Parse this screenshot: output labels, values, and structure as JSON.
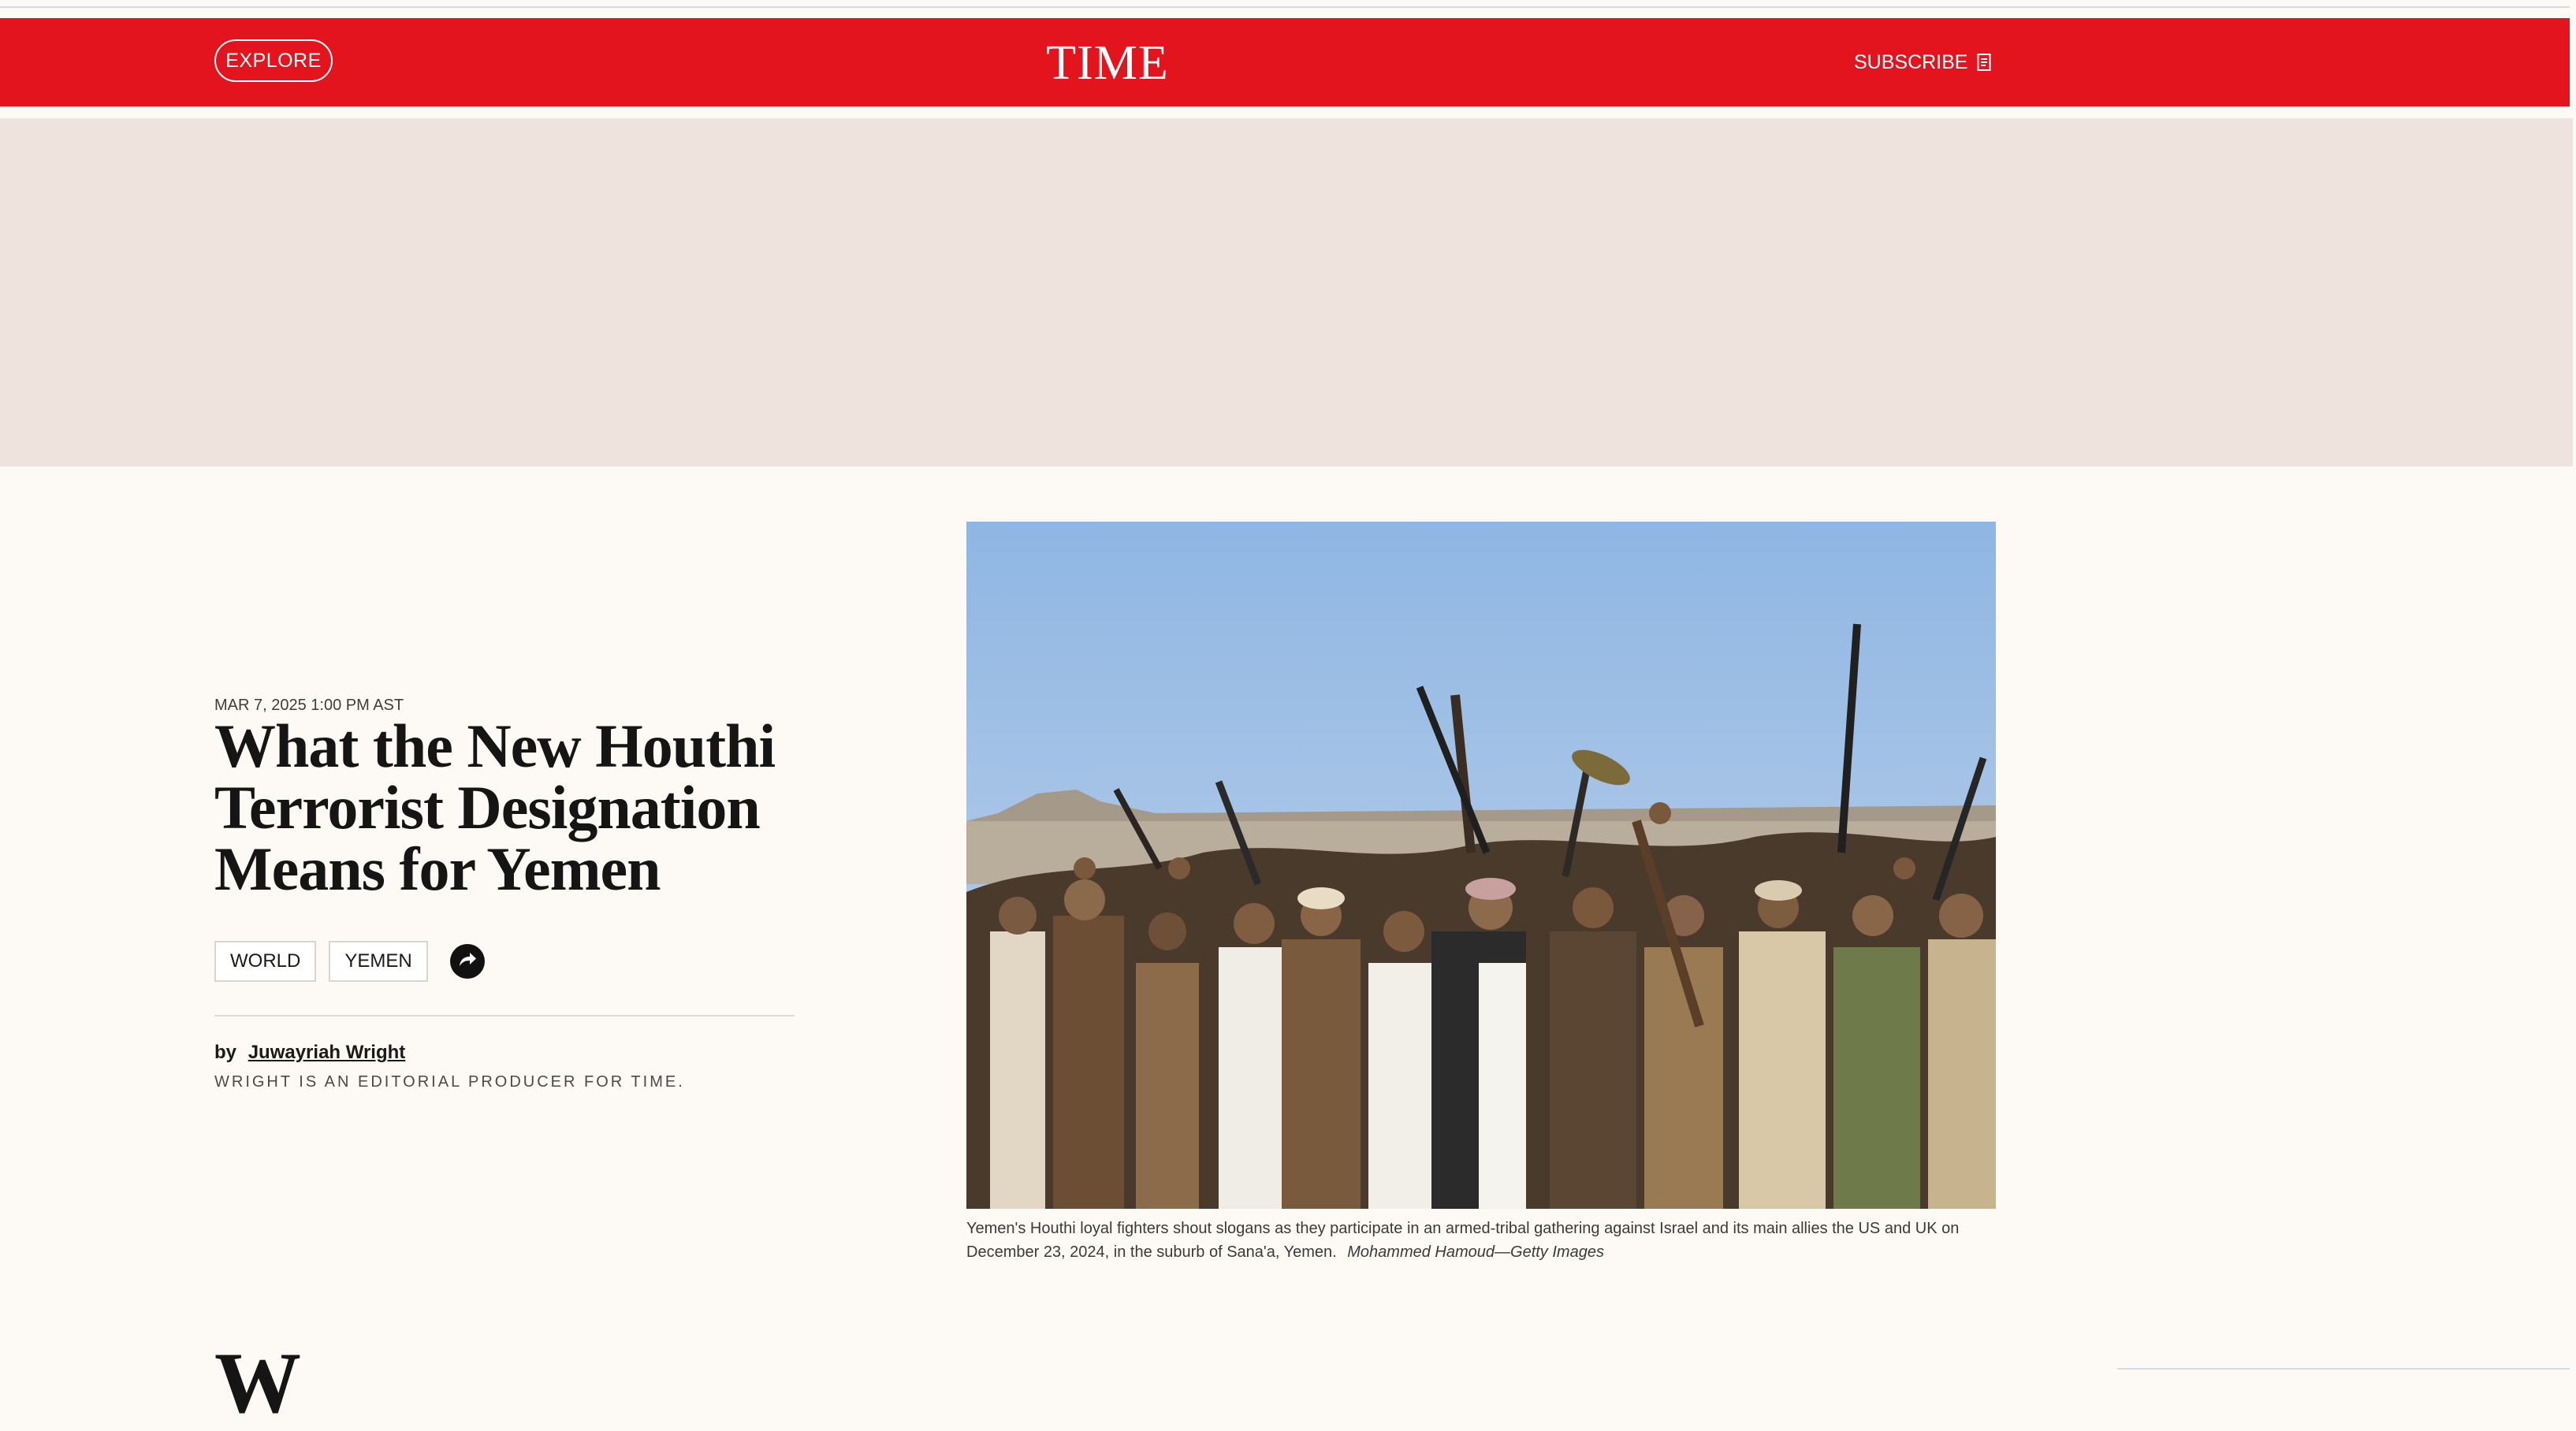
{
  "header": {
    "explore_label": "EXPLORE",
    "logo_text": "TIME",
    "subscribe_label": "SUBSCRIBE",
    "brand_color": "#e3141e"
  },
  "article": {
    "date": "MAR 7, 2025 1:00 PM AST",
    "headline": "What the New Houthi Terrorist Designation Means for Yemen",
    "tags": [
      "WORLD",
      "YEMEN"
    ],
    "share_icon": "share-arrow-icon",
    "byline_prefix": "by",
    "author": "Juwayriah Wright",
    "author_description": "WRIGHT IS AN EDITORIAL PRODUCER FOR TIME.",
    "photo": {
      "caption": "Yemen's Houthi loyal fighters shout slogans as they participate in an armed-tribal gathering against Israel and its main allies the US and UK on December 23, 2024, in the suburb of Sana'a, Yemen.",
      "credit": "Mohammed Hamoud—Getty Images"
    },
    "next_heading_fragment": "W"
  }
}
